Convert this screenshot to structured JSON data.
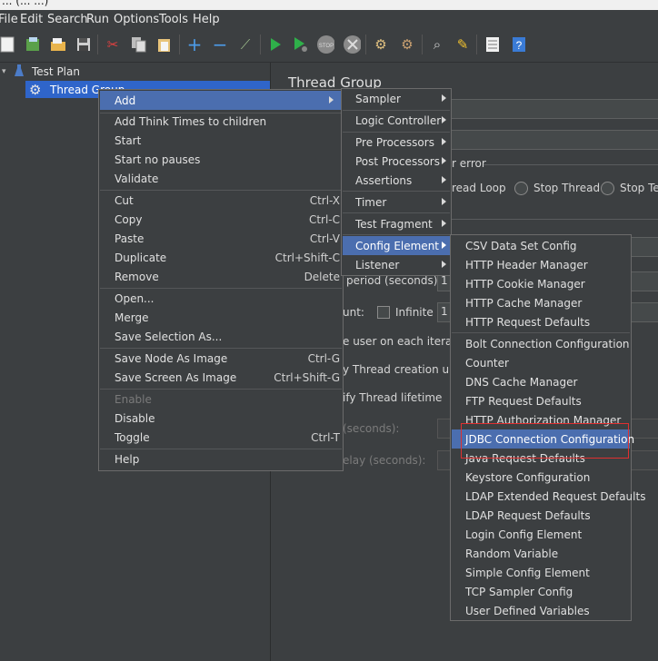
{
  "window_title": "... (... ...)",
  "menu_bar": [
    "File",
    "Edit",
    "Search",
    "Run",
    "Options",
    "Tools",
    "Help"
  ],
  "toolbar": {
    "icons": [
      "new-icon",
      "templates-icon",
      "open-icon",
      "save-icon",
      "cut-icon",
      "copy-icon",
      "paste-icon",
      "expand-icon",
      "collapse-icon",
      "toggle-icon",
      "start-icon",
      "start-no-pauses-icon",
      "stop-icon",
      "shutdown-icon",
      "clear-icon",
      "clear-all-icon",
      "search-icon",
      "reset-search-icon",
      "function-helper-icon",
      "help-icon"
    ]
  },
  "tree": {
    "test_plan": "Test Plan",
    "thread_group": "Thread Group"
  },
  "panel": {
    "title": "Thread Group",
    "action_error": "r error",
    "radio_loop": "read Loop",
    "radio_stop_thread": "Stop Thread",
    "radio_stop_test": "Stop Tes",
    "ramp_period": " period (seconds):",
    "ramp_value": "1",
    "loop_count": "unt:",
    "infinite": "Infinite",
    "loop_value": "1",
    "same_user": "e user on each iteratio",
    "delay_creation": "y Thread creation until",
    "specify_lifetime": "ify Thread lifetime",
    "duration": "(seconds):",
    "startup_delay": "elay (seconds):"
  },
  "context_menu": {
    "items": [
      {
        "label": "Add",
        "shortcut": "",
        "submenu": true,
        "highlight": true
      },
      {
        "label": "Add Think Times to children",
        "shortcut": ""
      },
      {
        "label": "Start",
        "shortcut": ""
      },
      {
        "label": "Start no pauses",
        "shortcut": ""
      },
      {
        "label": "Validate",
        "shortcut": ""
      },
      {
        "label": "Cut",
        "shortcut": "Ctrl-X"
      },
      {
        "label": "Copy",
        "shortcut": "Ctrl-C"
      },
      {
        "label": "Paste",
        "shortcut": "Ctrl-V"
      },
      {
        "label": "Duplicate",
        "shortcut": "Ctrl+Shift-C"
      },
      {
        "label": "Remove",
        "shortcut": "Delete"
      },
      {
        "label": "Open...",
        "shortcut": ""
      },
      {
        "label": "Merge",
        "shortcut": ""
      },
      {
        "label": "Save Selection As...",
        "shortcut": ""
      },
      {
        "label": "Save Node As Image",
        "shortcut": "Ctrl-G"
      },
      {
        "label": "Save Screen As Image",
        "shortcut": "Ctrl+Shift-G"
      },
      {
        "label": "Enable",
        "shortcut": "",
        "disabled": true
      },
      {
        "label": "Disable",
        "shortcut": ""
      },
      {
        "label": "Toggle",
        "shortcut": "Ctrl-T"
      },
      {
        "label": "Help",
        "shortcut": ""
      }
    ]
  },
  "add_submenu": {
    "items": [
      "Sampler",
      "Logic Controller",
      "Pre Processors",
      "Post Processors",
      "Assertions",
      "Timer",
      "Test Fragment",
      "Config Element",
      "Listener"
    ],
    "highlighted": "Config Element"
  },
  "config_submenu": {
    "items": [
      "CSV Data Set Config",
      "HTTP Header Manager",
      "HTTP Cookie Manager",
      "HTTP Cache Manager",
      "HTTP Request Defaults",
      "Bolt Connection Configuration",
      "Counter",
      "DNS Cache Manager",
      "FTP Request Defaults",
      "HTTP Authorization Manager",
      "JDBC Connection Configuration",
      "Java Request Defaults",
      "Keystore Configuration",
      "LDAP Extended Request Defaults",
      "LDAP Request Defaults",
      "Login Config Element",
      "Random Variable",
      "Simple Config Element",
      "TCP Sampler Config",
      "User Defined Variables"
    ],
    "highlighted": "JDBC Connection Configuration"
  },
  "colors": {
    "highlight": "#4b6eaf",
    "tree_selection": "#2f65ca",
    "annotation_box": "#e03030",
    "background": "#3c3f41"
  }
}
